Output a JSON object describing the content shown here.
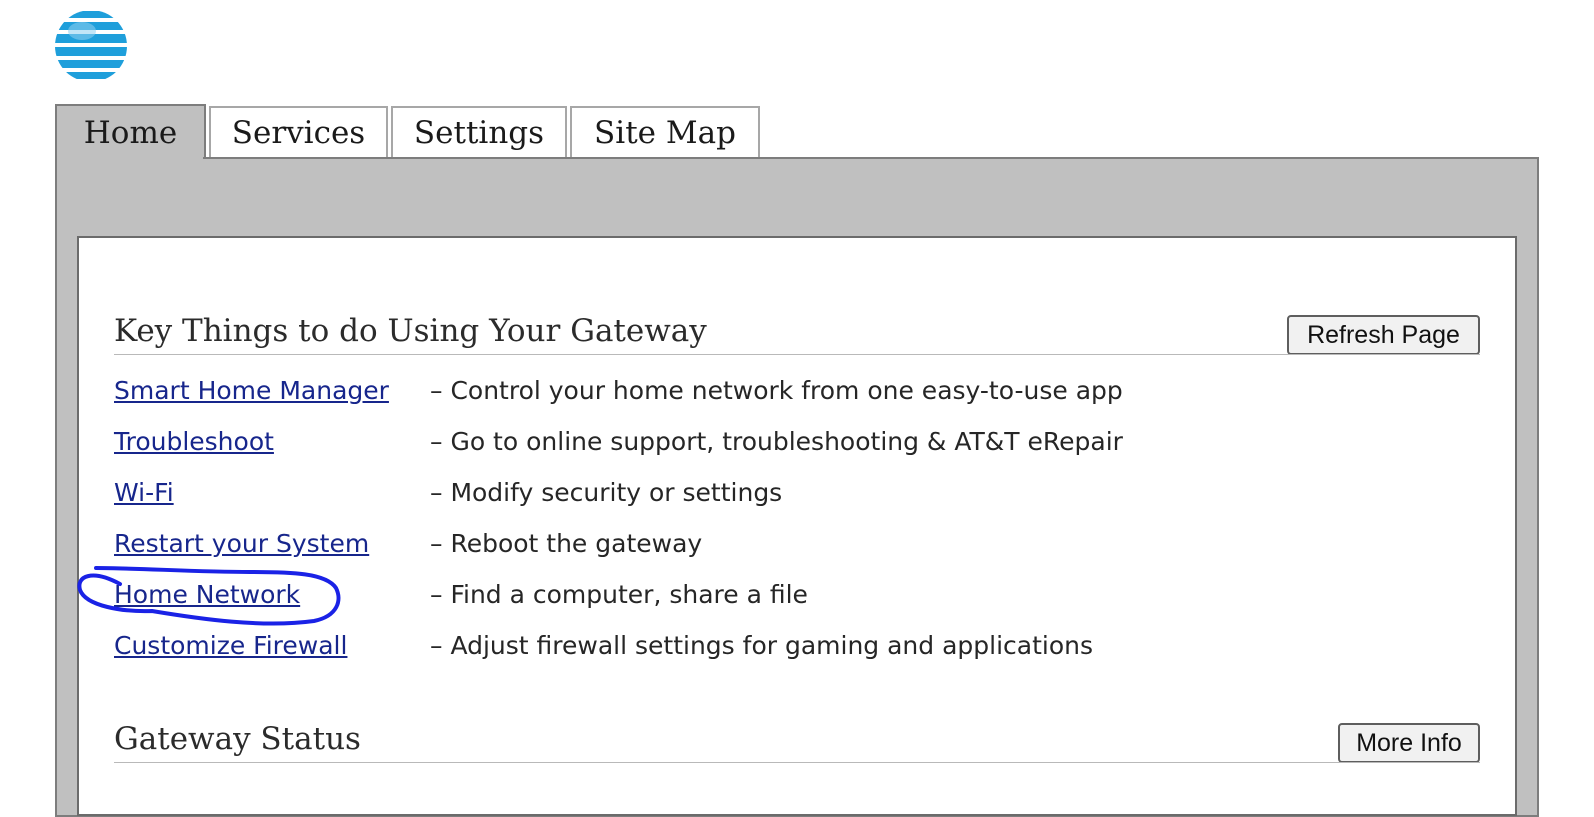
{
  "logo": {
    "icon": "att-globe-icon",
    "colors": {
      "blue": "#1f9fdb",
      "light_blue": "#8fd0f0"
    }
  },
  "tabs": [
    {
      "label": "Home",
      "active": true
    },
    {
      "label": "Services",
      "active": false
    },
    {
      "label": "Settings",
      "active": false
    },
    {
      "label": "Site Map",
      "active": false
    }
  ],
  "key_things": {
    "title": "Key Things to do Using Your Gateway",
    "refresh_button": "Refresh Page",
    "items": [
      {
        "link": "Smart Home Manager",
        "description": "– Control your home network from one easy-to-use app"
      },
      {
        "link": "Troubleshoot",
        "description": "– Go to online support, troubleshooting & AT&T eRepair"
      },
      {
        "link": "Wi-Fi",
        "description": "– Modify security or settings"
      },
      {
        "link": "Restart your System",
        "description": "– Reboot the gateway"
      },
      {
        "link": "Home Network",
        "description": "– Find a computer, share a file"
      },
      {
        "link": "Customize Firewall",
        "description": "– Adjust firewall settings for gaming and applications"
      }
    ]
  },
  "gateway_status": {
    "title": "Gateway Status",
    "more_info_button": "More Info"
  },
  "annotation": {
    "color": "#1a22e6",
    "circled_item": "Home Network"
  }
}
